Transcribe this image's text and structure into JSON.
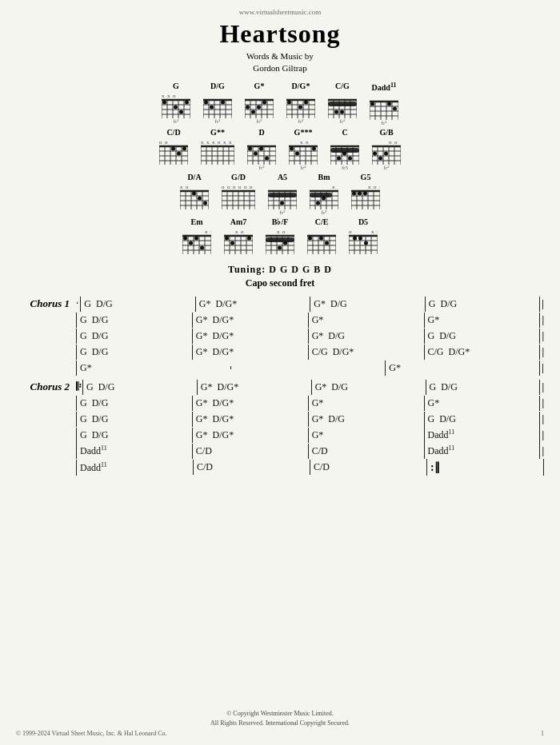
{
  "page": {
    "url": "www.virtualsheetmusic.com",
    "title": "Heartsong",
    "subtitle_line1": "Words & Music by",
    "subtitle_line2": "Gordon Giltrap",
    "tuning": "Tuning: D  G  D  G  B  D",
    "capo": "Capo second fret"
  },
  "chord_diagrams": {
    "row1": [
      "G",
      "D/G",
      "G*",
      "D/G*",
      "C/G",
      "Dadd11"
    ],
    "row2": [
      "C/D",
      "G**",
      "D",
      "G***",
      "C",
      "G/B"
    ],
    "row3": [
      "D/A",
      "G/D",
      "A5",
      "Bm",
      "G5"
    ],
    "row4": [
      "Em",
      "Am7",
      "Bb/F",
      "C/E",
      "D5"
    ]
  },
  "chorus1": {
    "label": "Chorus 1",
    "rows": [
      {
        "bars": [
          "G  D/G",
          "G*  D/G*",
          "G*  D/G",
          "G  D/G"
        ]
      },
      {
        "bars": [
          "G  D/G",
          "G*  D/G*",
          "G*",
          "G*"
        ]
      },
      {
        "bars": [
          "G  D/G",
          "G*  D/G*",
          "G*  D/G",
          "G  D/G"
        ]
      },
      {
        "bars": [
          "G  D/G",
          "G*  D/G*",
          "C/G  D/G*",
          "C/G  D/G*"
        ]
      },
      {
        "bars": [
          "G*",
          "",
          "G*",
          ""
        ]
      }
    ]
  },
  "chorus2": {
    "label": "Chorus 2",
    "rows": [
      {
        "bars": [
          "G  D/G",
          "G*  D/G*",
          "G*  D/G",
          "G  D/G"
        ]
      },
      {
        "bars": [
          "G  D/G",
          "G*  D/G*",
          "G*",
          "G*"
        ]
      },
      {
        "bars": [
          "G  D/G",
          "G*  D/G*",
          "G*  D/G",
          "G  D/G"
        ]
      },
      {
        "bars": [
          "G  D/G",
          "G*  D/G*",
          "G*",
          "Dadd11"
        ]
      },
      {
        "bars": [
          "Dadd11",
          "C/D",
          "C/D",
          "Dadd11"
        ]
      },
      {
        "bars": [
          "Dadd11",
          "C/D",
          "C/D",
          ""
        ]
      }
    ]
  },
  "footer": {
    "copyright": "© Copyright Westminster Music Limited.",
    "rights": "All Rights Reserved. International Copyright Secured.",
    "bottom_left": "© 1999-2024 Virtual Sheet Music, Inc. & Hal Leonard Co."
  }
}
